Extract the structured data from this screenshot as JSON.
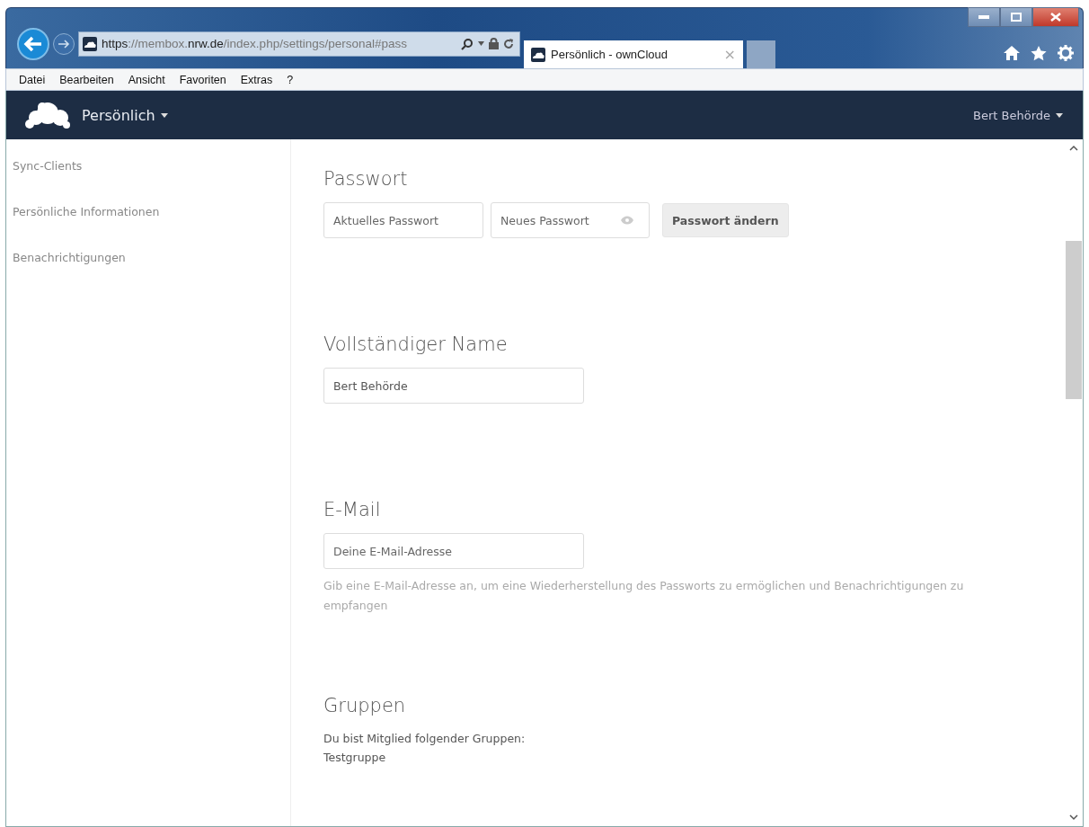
{
  "browser": {
    "address_parts": [
      {
        "text": "https",
        "emphasis": true
      },
      {
        "text": "://membox.",
        "emphasis": false
      },
      {
        "text": "nrw.de",
        "emphasis": true
      },
      {
        "text": "/index.php/settings/personal#pass",
        "emphasis": false
      }
    ],
    "tabs": [
      {
        "label": "Persönlich - ownCloud",
        "close": "×",
        "selected": true
      },
      {
        "selected": false
      }
    ],
    "menu": [
      {
        "label": "Datei"
      },
      {
        "label": "Bearbeiten"
      },
      {
        "label": "Ansicht"
      },
      {
        "label": "Favoriten"
      },
      {
        "label": "Extras"
      },
      {
        "label": "?"
      }
    ]
  },
  "header": {
    "app_menu": "Persönlich",
    "user_menu": "Bert Behörde"
  },
  "sidebar": {
    "items": [
      {
        "label": "Sync-Clients"
      },
      {
        "label": "Persönliche Informationen"
      },
      {
        "label": "Benachrichtigungen"
      }
    ]
  },
  "sections": [
    {
      "kind": "password",
      "title": "Passwort",
      "current_placeholder": "Aktuelles Passwort",
      "new_placeholder": "Neues Passwort",
      "button": "Passwort ändern"
    },
    {
      "kind": "field",
      "title": "Vollständiger Name",
      "value": "Bert Behörde"
    },
    {
      "kind": "field",
      "title": "E-Mail",
      "placeholder": "Deine E-Mail-Adresse",
      "hint": "Gib eine E-Mail-Adresse an, um eine Wiederherstellung des Passworts zu ermöglichen und Benachrichtigungen zu empfangen"
    },
    {
      "kind": "groups",
      "title": "Gruppen",
      "intro": "Du bist Mitglied folgender Gruppen:",
      "groups": [
        "Testgruppe"
      ]
    }
  ]
}
